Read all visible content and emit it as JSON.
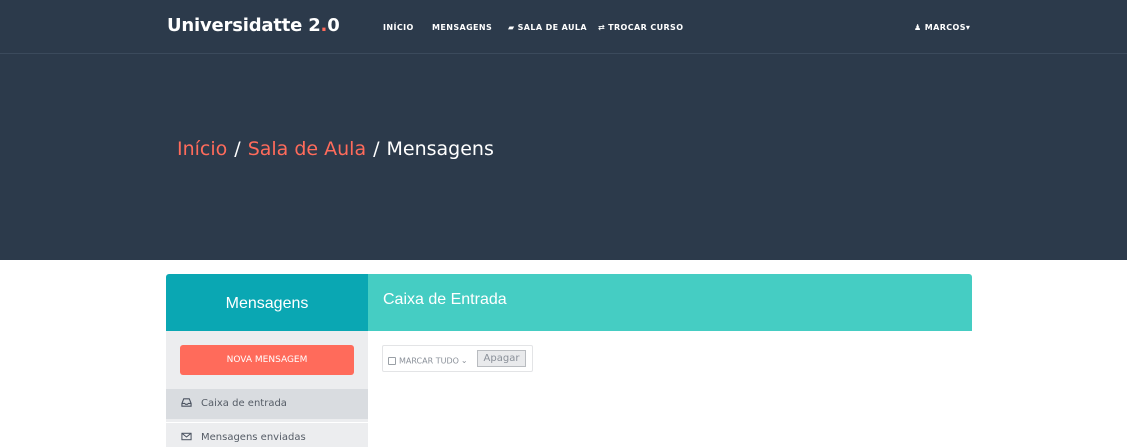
{
  "navbar": {
    "brand_main": "Universidatte 2",
    "brand_dot": ".",
    "brand_end": "0",
    "links": [
      {
        "label": "INÍCIO",
        "icon": ""
      },
      {
        "label": "MENSAGENS",
        "icon": ""
      },
      {
        "label": "SALA DE AULA",
        "icon": "book-icon"
      },
      {
        "label": "TROCAR CURSO",
        "icon": "exchange-icon"
      }
    ],
    "user": {
      "name": "MARCOS",
      "icon": "user-icon",
      "caret_icon": "caret-down-icon"
    }
  },
  "breadcrumb": {
    "items": [
      "Início",
      "Sala de Aula"
    ],
    "separator": "/",
    "current": "Mensagens"
  },
  "sidebar": {
    "title": "Mensagens",
    "new_button": "NOVA MENSAGEM",
    "items": [
      {
        "label": "Caixa de entrada",
        "icon": "inbox-icon",
        "active": true
      },
      {
        "label": "Mensagens enviadas",
        "icon": "envelope-icon",
        "active": false
      }
    ]
  },
  "main": {
    "title": "Caixa de Entrada",
    "toolbar": {
      "select_all_label": "MARCAR TUDO",
      "delete_label": "Apagar"
    }
  },
  "colors": {
    "hero_bg": "#2c3a4b",
    "accent": "#ff6b5b",
    "sidebar_header": "#0aa7b3",
    "main_header": "#45cdc3",
    "sidebar_bg": "#ecedef"
  }
}
